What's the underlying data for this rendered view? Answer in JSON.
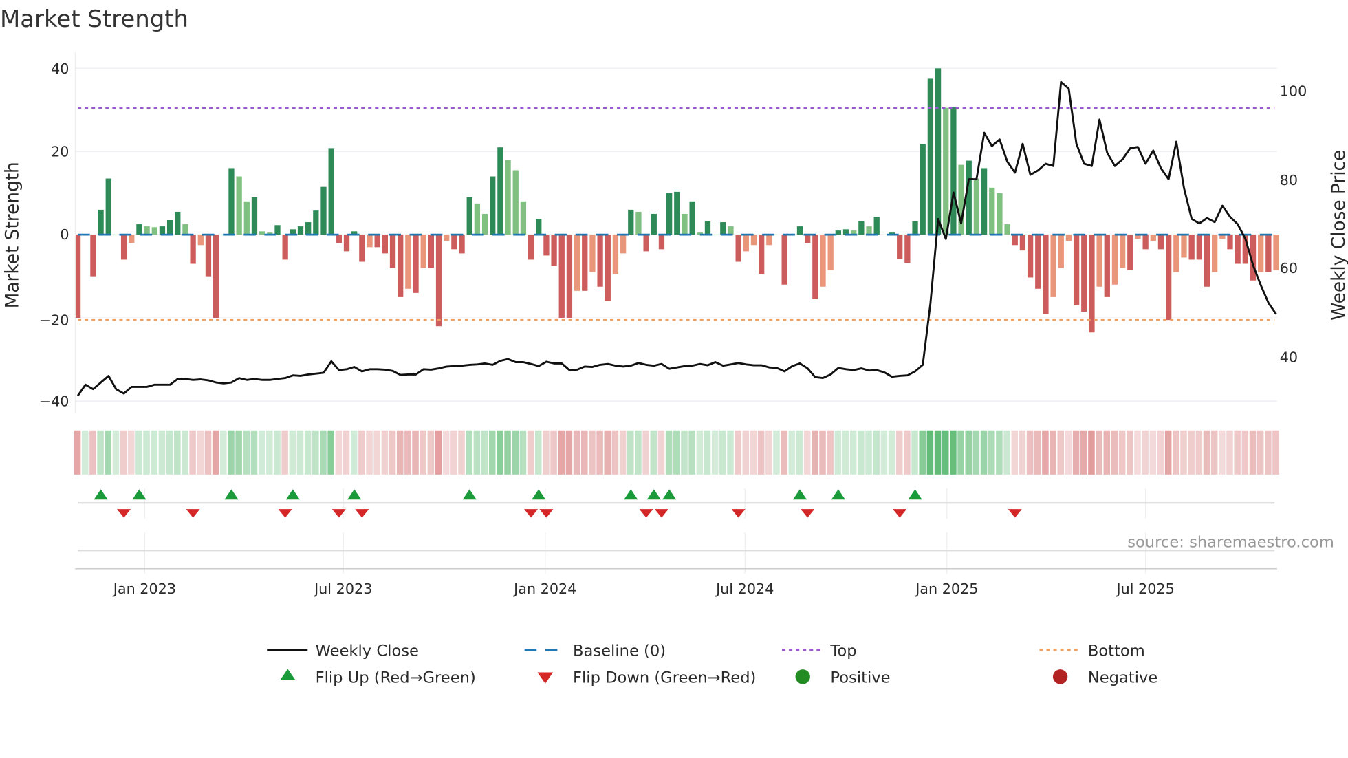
{
  "chart_data": {
    "type": "bar",
    "title": "Market Strength",
    "ylabel": "Market Strength",
    "y2label": "Weekly Close Price",
    "ylim": [
      -40,
      40
    ],
    "y2lim": [
      29.8,
      105.1
    ],
    "start_week": "2022-11-01",
    "yticks": [
      "40",
      "20",
      "0",
      "−20",
      "−40"
    ],
    "y2ticks": [
      "100",
      "80",
      "60",
      "40"
    ],
    "xticks": [
      {
        "label": "Jan 2023",
        "date": "2023-01-01"
      },
      {
        "label": "Jul 2023",
        "date": "2023-07-01"
      },
      {
        "label": "Jan 2024",
        "date": "2024-01-01"
      },
      {
        "label": "Jul 2024",
        "date": "2024-07-01"
      },
      {
        "label": "Jan 2025",
        "date": "2025-01-01"
      },
      {
        "label": "Jul 2025",
        "date": "2025-07-01"
      }
    ],
    "top_level": 30.5,
    "bottom_level": -20.5,
    "strength": [
      -20,
      0,
      -10,
      6,
      13.5,
      0,
      -6,
      -2,
      2.5,
      2,
      1.8,
      2,
      3.5,
      5.5,
      2.5,
      -7,
      -2.5,
      -10,
      -20,
      0,
      16,
      14,
      8,
      9,
      0.8,
      0.5,
      2.3,
      -6,
      1.3,
      2,
      3,
      5.8,
      11.5,
      20.8,
      -2,
      -4,
      0.8,
      -6.5,
      -3,
      -3,
      -4.5,
      -8,
      -15,
      -13,
      -14,
      -8,
      -8,
      -22,
      -1.5,
      -3.5,
      -4.5,
      9,
      7.5,
      5,
      14,
      21,
      18,
      15.5,
      8,
      -6,
      3.8,
      -5,
      -7.5,
      -20,
      -20,
      -13.5,
      -13.5,
      -9,
      -12.5,
      -16,
      -9.5,
      -4.5,
      6,
      5.5,
      -4,
      5,
      -3.5,
      10,
      10.3,
      5,
      8,
      0.5,
      3.3,
      0,
      3,
      2,
      -6.5,
      -4,
      -2.5,
      -9.5,
      -2.5,
      0,
      -12,
      0,
      2,
      -2,
      -15.5,
      -12.5,
      -8.5,
      1,
      1.3,
      1,
      3.2,
      2,
      4.3,
      0,
      0.5,
      -5.8,
      -6.8,
      3.2,
      21.8,
      37.5,
      40,
      30.5,
      30.8,
      16.8,
      17.8,
      13.5,
      16,
      11.3,
      10,
      2.5,
      -2.5,
      -3.8,
      -10.3,
      -13,
      -19,
      -15,
      -8,
      -1.5,
      -17,
      -18.5,
      -23.5,
      -12.5,
      -15,
      -12,
      -8,
      -8.5,
      -1,
      -3.5,
      -1.5,
      -3.5,
      -20.5,
      -9,
      -5.5,
      -6,
      -6,
      -12.5,
      -9,
      -1,
      -3.5,
      -7,
      -7,
      -11,
      -9,
      -9,
      -8.5
    ],
    "weekly_close": [
      31,
      33.5,
      32.5,
      34,
      35.5,
      32.5,
      31.5,
      33,
      33,
      33,
      33.5,
      33.5,
      33.5,
      34.8,
      34.8,
      34.6,
      34.7,
      34.5,
      34,
      33.8,
      34,
      35,
      34.6,
      34.8,
      34.6,
      34.6,
      34.8,
      35,
      35.6,
      35.5,
      35.8,
      36,
      36.2,
      38.8,
      36.8,
      37,
      37.5,
      36.5,
      37,
      37,
      36.9,
      36.6,
      35.7,
      35.8,
      35.8,
      37,
      36.9,
      37.2,
      37.6,
      37.7,
      37.8,
      38,
      38.1,
      38.3,
      38,
      38.9,
      39.3,
      38.6,
      38.6,
      38.2,
      37.7,
      38.7,
      38.3,
      38.3,
      36.8,
      36.9,
      37.6,
      37.5,
      38,
      38.2,
      37.8,
      37.6,
      37.8,
      38.4,
      38,
      37.8,
      38.2,
      37.1,
      37.4,
      37.7,
      37.8,
      38.2,
      37.9,
      38.6,
      37.8,
      38.1,
      38.4,
      38.1,
      37.9,
      37.9,
      37.4,
      37.3,
      36.5,
      37.7,
      38.3,
      37.2,
      35.2,
      35,
      35.8,
      37.3,
      37,
      36.8,
      37.2,
      36.7,
      36.8,
      36.3,
      35.3,
      35.5,
      35.6,
      36.5,
      38,
      52,
      71,
      66.5,
      77,
      70,
      80,
      80,
      90.5,
      87.5,
      89,
      84,
      81.5,
      88,
      81,
      82,
      83.5,
      83,
      102,
      100.5,
      88,
      83.5,
      83,
      93.5,
      86,
      83,
      84.5,
      87,
      87.3,
      83.5,
      86.5,
      82.5,
      80,
      88.5,
      78,
      71,
      70,
      71.2,
      70.3,
      74,
      71.5,
      69.8,
      66.5,
      60.5,
      56,
      52,
      49.5
    ],
    "colors": {
      "pos_strong": "#2e8b57",
      "pos_weak": "#80c080",
      "neg_strong": "#cd5c5c",
      "neg_weak": "#e9967a",
      "baseline": "#1f77b4",
      "top": "#9b59d0",
      "bottom": "#f0a060",
      "close": "#111111",
      "flip_up": "#1a9a3a",
      "flip_down": "#d62728",
      "positive": "#228b22",
      "negative": "#b22222"
    },
    "legend": {
      "weekly_close": "Weekly Close",
      "baseline": "Baseline (0)",
      "top": "Top",
      "bottom": "Bottom",
      "flip_up": "Flip Up (Red→Green)",
      "flip_down": "Flip Down (Green→Red)",
      "positive": "Positive",
      "negative": "Negative"
    },
    "source": "source: sharemaestro.com"
  }
}
